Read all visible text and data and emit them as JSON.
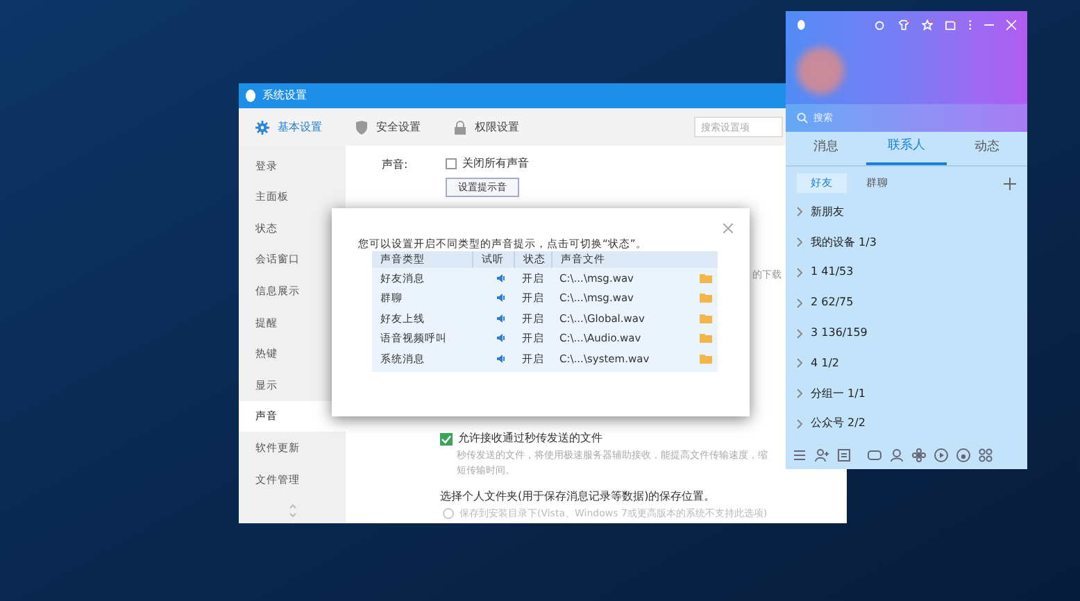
{
  "settings_window": {
    "title": "系统设置",
    "toolbar_tabs": [
      {
        "label": "基本设置",
        "selected": true
      },
      {
        "label": "安全设置",
        "selected": false
      },
      {
        "label": "权限设置",
        "selected": false
      }
    ],
    "search": {
      "placeholder": "搜索设置项"
    },
    "sidebar": [
      {
        "label": "登录",
        "selected": false
      },
      {
        "label": "主面板",
        "selected": false
      },
      {
        "label": "状态",
        "selected": false
      },
      {
        "label": "会话窗口",
        "selected": false
      },
      {
        "label": "信息展示",
        "selected": false
      },
      {
        "label": "提醒",
        "selected": false
      },
      {
        "label": "热键",
        "selected": false
      },
      {
        "label": "显示",
        "selected": false
      },
      {
        "label": "声音",
        "selected": true
      },
      {
        "label": "软件更新",
        "selected": false
      },
      {
        "label": "文件管理",
        "selected": false
      }
    ],
    "sound_label": "声音:",
    "mute_all": {
      "label": "关闭所有声音",
      "checked": false
    },
    "set_sound_button": "设置提示音",
    "partial_text": "的下载",
    "receive_files": {
      "label": "允许接收通过秒传发送的文件",
      "checked": true,
      "description": "秒传发送的文件，将使用极速服务器辅助接收，能提高文件传输速度，缩短传输时间。"
    },
    "folder_heading": "选择个人文件夹(用于保存消息记录等数据)的保存位置。",
    "install_dir_option": {
      "label": "保存到安装目录下(Vista、Windows 7或更高版本的系统不支持此选项)",
      "selected": false
    }
  },
  "dialog": {
    "intro": "您可以设置开启不同类型的声音提示，点击可切换“状态”。",
    "columns": [
      "声音类型",
      "试听",
      "状态",
      "声音文件"
    ],
    "rows": [
      {
        "type": "好友消息",
        "status": "开启",
        "file": "C:\\...\\msg.wav"
      },
      {
        "type": "群聊",
        "status": "开启",
        "file": "C:\\...\\msg.wav"
      },
      {
        "type": "好友上线",
        "status": "开启",
        "file": "C:\\...\\Global.wav"
      },
      {
        "type": "语音视频呼叫",
        "status": "开启",
        "file": "C:\\...\\Audio.wav"
      },
      {
        "type": "系统消息",
        "status": "开启",
        "file": "C:\\...\\system.wav"
      }
    ]
  },
  "qq_panel": {
    "search": {
      "placeholder": "搜索"
    },
    "tabs": [
      {
        "label": "消息",
        "selected": false
      },
      {
        "label": "联系人",
        "selected": true
      },
      {
        "label": "动态",
        "selected": false
      }
    ],
    "subtabs": [
      {
        "label": "好友",
        "selected": true
      },
      {
        "label": "群聊",
        "selected": false
      }
    ],
    "groups": [
      "新朋友",
      "我的设备 1/3",
      "1 41/53",
      "2 62/75",
      "3 136/159",
      "4 1/2",
      "分组一 1/1",
      "公众号 2/2"
    ]
  }
}
